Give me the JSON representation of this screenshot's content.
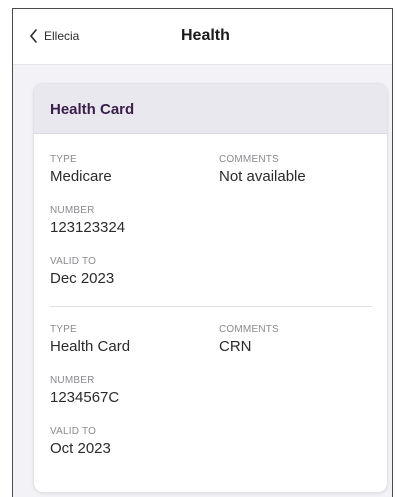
{
  "header": {
    "back_label": "Ellecia",
    "title": "Health"
  },
  "card": {
    "title": "Health Card",
    "entries": [
      {
        "type_label": "TYPE",
        "type_value": "Medicare",
        "comments_label": "COMMENTS",
        "comments_value": "Not available",
        "number_label": "NUMBER",
        "number_value": "123123324",
        "valid_label": "VALID TO",
        "valid_value": "Dec 2023"
      },
      {
        "type_label": "TYPE",
        "type_value": "Health Card",
        "comments_label": "COMMENTS",
        "comments_value": "CRN",
        "number_label": "NUMBER",
        "number_value": "1234567C",
        "valid_label": "VALID TO",
        "valid_value": "Oct 2023"
      }
    ]
  },
  "colors": {
    "card_title": "#3b1f4a",
    "page_background": "#f3f2f6",
    "card_header_background": "#e9e8ef"
  },
  "icons": {
    "back": "chevron-left-icon"
  }
}
